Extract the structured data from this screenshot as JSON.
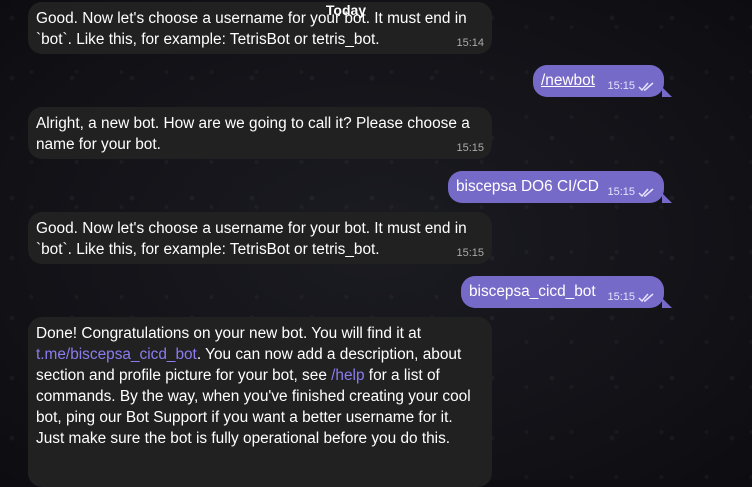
{
  "date_separator": "Today",
  "messages": [
    {
      "text": "Good. Now let's choose a username for your bot. It must end in `bot`. Like this, for example: TetrisBot or tetris_bot.",
      "time": "15:14"
    },
    {
      "text": "/newbot",
      "time": "15:15"
    },
    {
      "text": "Alright, a new bot. How are we going to call it? Please choose a name for your bot.",
      "time": "15:15"
    },
    {
      "text": "biscepsa DO6 CI/CD",
      "time": "15:15"
    },
    {
      "text": "Good. Now let's choose a username for your bot. It must end in `bot`. Like this, for example: TetrisBot or tetris_bot.",
      "time": "15:15"
    },
    {
      "text": "biscepsa_cicd_bot",
      "time": "15:15"
    },
    {
      "part1": "Done! Congratulations on your new bot. You will find it at ",
      "link1": "t.me/biscepsa_cicd_bot",
      "part2": ". You can now add a description, about section and profile picture for your bot, see ",
      "link2": "/help",
      "part3": " for a list of commands. By the way, when you've finished creating your cool bot, ping our Bot Support if you want a better username for it. Just make sure the bot is fully operational before you do this."
    }
  ],
  "colors": {
    "incoming": "#212121",
    "outgoing": "#766ac8",
    "link": "#8b7cf0"
  }
}
